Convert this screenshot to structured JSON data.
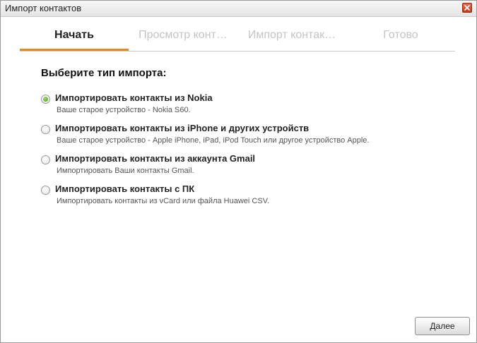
{
  "window": {
    "title": "Импорт контактов",
    "close_icon": "close-x-icon"
  },
  "steps": [
    {
      "label": "Начать",
      "active": true
    },
    {
      "label": "Просмотр конт…",
      "active": false
    },
    {
      "label": "Импорт контак…",
      "active": false
    },
    {
      "label": "Готово",
      "active": false
    }
  ],
  "heading": "Выберите тип импорта:",
  "options": [
    {
      "title": "Импортировать контакты из Nokia",
      "description": "Ваше старое устройство - Nokia S60.",
      "selected": true
    },
    {
      "title": "Импортировать контакты из iPhone и других устройств",
      "description": "Ваше старое устройство - Apple iPhone, iPad, iPod Touch или другое устройство Apple.",
      "selected": false
    },
    {
      "title": "Импортировать контакты из аккаунта Gmail",
      "description": "Импортировать Ваши контакты Gmail.",
      "selected": false
    },
    {
      "title": "Импортировать контакты с ПК",
      "description": "Импортировать контакты из vCard или файла Huawei CSV.",
      "selected": false
    }
  ],
  "buttons": {
    "next_label": "Далее"
  },
  "colors": {
    "accent": "#e8891f",
    "radio_selected": "#3f9a1b",
    "close": "#c43a1c"
  }
}
